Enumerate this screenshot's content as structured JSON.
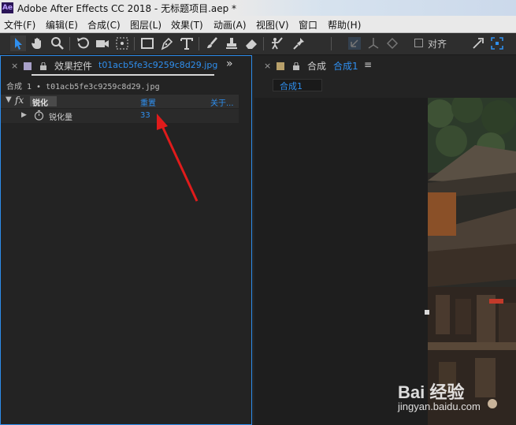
{
  "window": {
    "app_icon": "Ae",
    "title": "Adobe After Effects CC 2018 - 无标题项目.aep *"
  },
  "menu": [
    "文件(F)",
    "编辑(E)",
    "合成(C)",
    "图层(L)",
    "效果(T)",
    "动画(A)",
    "视图(V)",
    "窗口",
    "帮助(H)"
  ],
  "toolbar": {
    "tools": [
      "selection-tool-icon",
      "hand-tool-icon",
      "zoom-tool-icon",
      "rotate-tool-icon",
      "camera-tool-icon",
      "pan-behind-tool-icon",
      "rectangle-tool-icon",
      "pen-tool-icon",
      "type-tool-icon",
      "brush-tool-icon",
      "clone-stamp-tool-icon",
      "eraser-tool-icon",
      "roto-brush-tool-icon",
      "puppet-pin-tool-icon"
    ],
    "align_label": "对齐"
  },
  "effects_panel": {
    "close": "×",
    "tab_label": "效果控件",
    "tab_file": "t01acb5fe3c9259c8d29.jpg",
    "menu_glyph": "»",
    "subtitle": "合成 1 • t01acb5fe3c9259c8d29.jpg",
    "effect": {
      "fx_glyph": "fx",
      "name": "锐化",
      "reset_label": "重置",
      "about_label": "关于..."
    },
    "param": {
      "label": "锐化量",
      "value": "33"
    }
  },
  "composition_panel": {
    "close": "×",
    "tab_label": "合成",
    "tab_comp": "合成1",
    "menu_glyph": "≡",
    "comp_tab": "合成1"
  },
  "watermark": {
    "brand": "Bai 经验",
    "url": "jingyan.baidu.com"
  },
  "colors": {
    "accent": "#2f8fef",
    "arrow": "#e01b1b",
    "panel_border": "#2d8ceb"
  }
}
